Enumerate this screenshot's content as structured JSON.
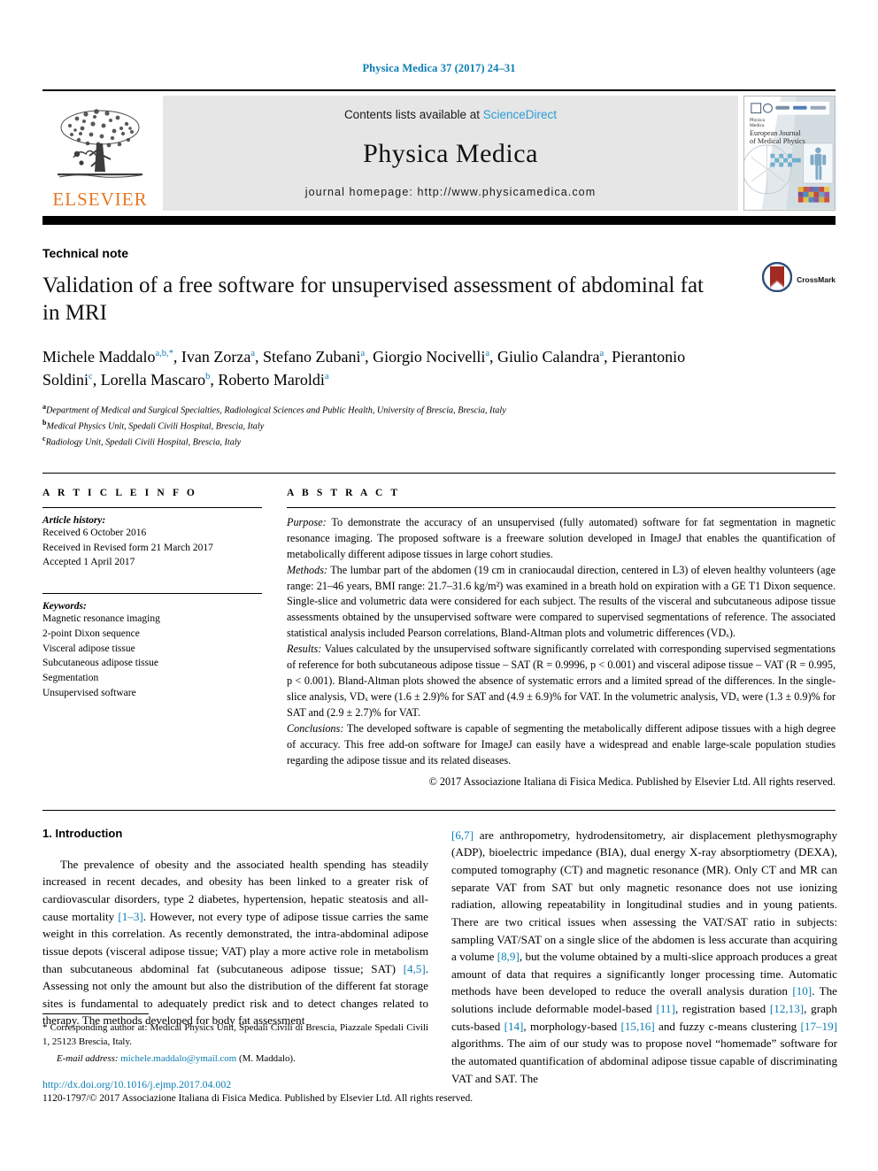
{
  "running_head": "Physica Medica 37 (2017) 24–31",
  "masthead": {
    "contents_prefix": "Contents lists available at ",
    "sciencedirect": "ScienceDirect",
    "journal_title": "Physica Medica",
    "homepage": "journal homepage: http://www.physicamedica.com",
    "publisher_wordmark": "ELSEVIER",
    "publisher_logo_icon": "elsevier-tree-icon",
    "cover_line1": "Physica",
    "cover_line2": "Medica",
    "cover_line3": "European Journal",
    "cover_line4": "of Medical Physics"
  },
  "article": {
    "doctype": "Technical note",
    "title": "Validation of a free software for unsupervised assessment of abdominal fat in MRI",
    "crossmark_label": "CrossMark",
    "crossmark_icon": "crossmark-icon",
    "affiliations": [
      {
        "marker": "a",
        "text": "Department of Medical and Surgical Specialties, Radiological Sciences and Public Health, University of Brescia, Brescia, Italy"
      },
      {
        "marker": "b",
        "text": "Medical Physics Unit, Spedali Civili Hospital, Brescia, Italy"
      },
      {
        "marker": "c",
        "text": "Radiology Unit, Spedali Civili Hospital, Brescia, Italy"
      }
    ],
    "authors": [
      {
        "name": "Michele Maddalo",
        "marks": "a,b,*"
      },
      {
        "name": "Ivan Zorza",
        "marks": "a"
      },
      {
        "name": "Stefano Zubani",
        "marks": "a"
      },
      {
        "name": "Giorgio Nocivelli",
        "marks": "a"
      },
      {
        "name": "Giulio Calandra",
        "marks": "a"
      },
      {
        "name": "Pierantonio Soldini",
        "marks": "c"
      },
      {
        "name": "Lorella Mascaro",
        "marks": "b"
      },
      {
        "name": "Roberto Maroldi",
        "marks": "a"
      }
    ]
  },
  "article_info": {
    "heading": "A R T I C L E    I N F O",
    "history_label": "Article history:",
    "history": [
      "Received 6 October 2016",
      "Received in Revised form 21 March 2017",
      "Accepted 1 April 2017"
    ],
    "keywords_label": "Keywords:",
    "keywords": [
      "Magnetic resonance imaging",
      "2-point Dixon sequence",
      "Visceral adipose tissue",
      "Subcutaneous adipose tissue",
      "Segmentation",
      "Unsupervised software"
    ]
  },
  "abstract": {
    "heading": "A B S T R A C T",
    "purpose_label": "Purpose:",
    "purpose": " To demonstrate the accuracy of an unsupervised (fully automated) software for fat segmentation in magnetic resonance imaging. The proposed software is a freeware solution developed in ImageJ that enables the quantification of metabolically different adipose tissues in large cohort studies.",
    "methods_label": "Methods:",
    "methods": " The lumbar part of the abdomen (19 cm in craniocaudal direction, centered in L3) of eleven healthy volunteers (age range: 21–46 years, BMI range: 21.7–31.6 kg/m²) was examined in a breath hold on expiration with a GE T1 Dixon sequence. Single-slice and volumetric data were considered for each subject. The results of the visceral and subcutaneous adipose tissue assessments obtained by the unsupervised software were compared to supervised segmentations of reference. The associated statistical analysis included Pearson correlations, Bland-Altman plots and volumetric differences (VDₓ).",
    "results_label": "Results:",
    "results": " Values calculated by the unsupervised software significantly correlated with corresponding supervised segmentations of reference for both subcutaneous adipose tissue – SAT (R = 0.9996, p < 0.001) and visceral adipose tissue – VAT (R = 0.995, p < 0.001). Bland-Altman plots showed the absence of systematic errors and a limited spread of the differences. In the single-slice analysis, VDₓ were (1.6 ± 2.9)% for SAT and (4.9 ± 6.9)% for VAT. In the volumetric analysis, VDₓ were (1.3 ± 0.9)% for SAT and (2.9 ± 2.7)% for VAT.",
    "conclusions_label": "Conclusions:",
    "conclusions": " The developed software is capable of segmenting the metabolically different adipose tissues with a high degree of accuracy. This free add-on software for ImageJ can easily have a widespread and enable large-scale population studies regarding the adipose tissue and its related diseases.",
    "copyright": "© 2017 Associazione Italiana di Fisica Medica. Published by Elsevier Ltd. All rights reserved."
  },
  "introduction": {
    "heading": "1. Introduction",
    "left_paragraph_part1": "The prevalence of obesity and the associated health spending has steadily increased in recent decades, and obesity has been linked to a greater risk of cardiovascular disorders, type 2 diabetes, hypertension, hepatic steatosis and all-cause mortality ",
    "ref_1_3": "[1–3]",
    "left_paragraph_part2": ". However, not every type of adipose tissue carries the same weight in this correlation. As recently demonstrated, the intra-abdominal adipose tissue depots (visceral adipose tissue; VAT) play a more active role in metabolism than subcutaneous abdominal fat (subcutaneous adipose tissue; SAT) ",
    "ref_4_5": "[4,5]",
    "left_paragraph_part3": ". Assessing not only the amount but also the distribution of the different fat storage sites is fundamental to adequately predict risk and to detect changes related to therapy. The methods developed for body fat assessment",
    "ref_6_7": "[6,7]",
    "right_part1": " are anthropometry, hydrodensitometry, air displacement plethysmography (ADP), bioelectric impedance (BIA), dual energy X-ray absorptiometry (DEXA), computed tomography (CT) and magnetic resonance (MR). Only CT and MR can separate VAT from SAT but only magnetic resonance does not use ionizing radiation, allowing repeatability in longitudinal studies and in young patients. There are two critical issues when assessing the VAT/SAT ratio in subjects: sampling VAT/SAT on a single slice of the abdomen is less accurate than acquiring a volume ",
    "ref_8_9": "[8,9]",
    "right_part2": ", but the volume obtained by a multi-slice approach produces a great amount of data that requires a significantly longer processing time. Automatic methods have been developed to reduce the overall analysis duration ",
    "ref_10": "[10]",
    "right_part3": ". The solutions include deformable model-based ",
    "ref_11": "[11]",
    "right_part4": ", registration based ",
    "ref_12_13": "[12,13]",
    "right_part5": ", graph cuts-based ",
    "ref_14": "[14]",
    "right_part6": ", morphology-based ",
    "ref_15_16": "[15,16]",
    "right_part7": " and fuzzy c-means clustering ",
    "ref_17_19": "[17–19]",
    "right_part8": " algorithms. The aim of our study was to propose novel “homemade” software for the automated quantification of abdominal adipose tissue capable of discriminating VAT and SAT. The"
  },
  "footnotes": {
    "corresponding_marker": "*",
    "corresponding": " Corresponding author at: Medical Physics Unit, Spedali Civili di Brescia, Piazzale Spedali Civili 1, 25123 Brescia, Italy.",
    "email_label": "E-mail address:",
    "email": "michele.maddalo@ymail.com",
    "email_suffix": " (M. Maddalo).",
    "doi": "http://dx.doi.org/10.1016/j.ejmp.2017.04.002",
    "issn_line": "1120-1797/© 2017 Associazione Italiana di Fisica Medica. Published by Elsevier Ltd. All rights reserved."
  },
  "colors": {
    "link": "#0b7db3",
    "elsevier_orange": "#e77724",
    "masthead_grey": "#e6e6e6",
    "crossmark_red": "#a02b22",
    "crossmark_blue": "#2f4d7a"
  }
}
